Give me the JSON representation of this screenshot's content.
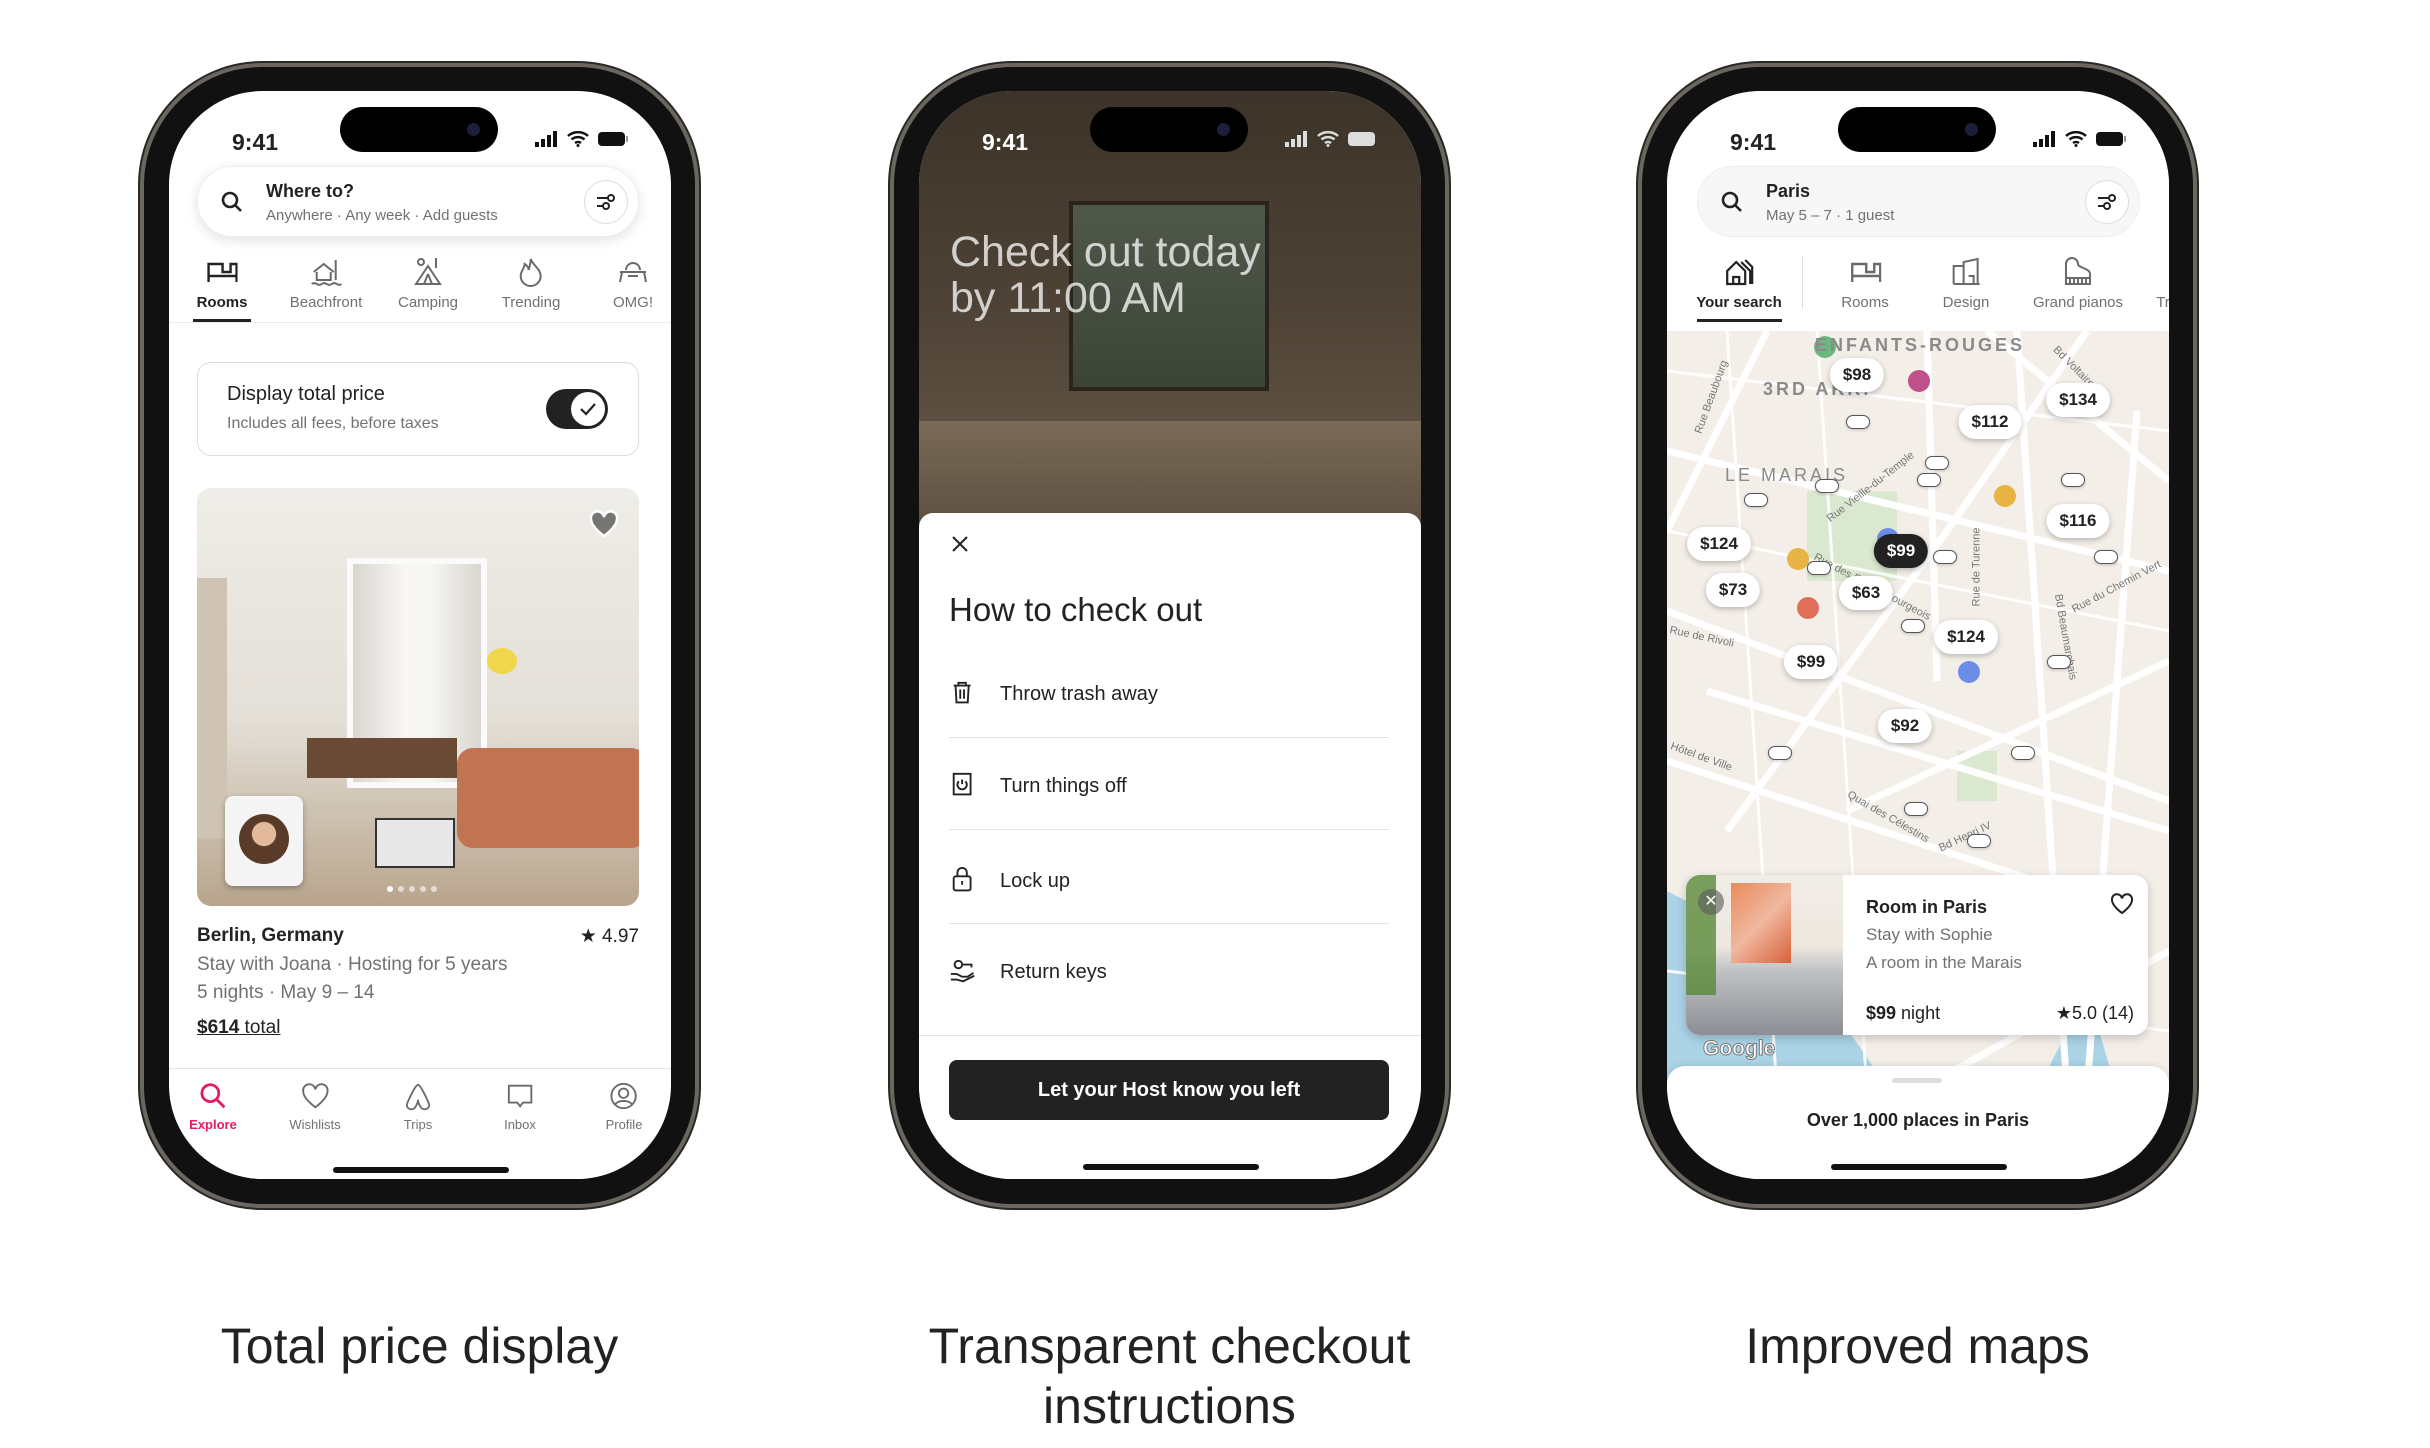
{
  "status_time": "9:41",
  "phone1": {
    "search": {
      "title": "Where to?",
      "subtitle": "Anywhere · Any week · Add guests"
    },
    "categories": [
      {
        "label": "Rooms",
        "icon": "bed-icon"
      },
      {
        "label": "Beachfront",
        "icon": "beach-house-icon"
      },
      {
        "label": "Camping",
        "icon": "tent-icon"
      },
      {
        "label": "Trending",
        "icon": "flame-icon"
      },
      {
        "label": "OMG!",
        "icon": "ufo-icon"
      }
    ],
    "toggle": {
      "title": "Display total price",
      "subtitle": "Includes all fees, before taxes",
      "on": true
    },
    "listing": {
      "location": "Berlin, Germany",
      "rating": "4.97",
      "host": "Stay with Joana · Hosting for 5 years",
      "dates": "5 nights · May 9 – 14",
      "price": "$614",
      "price_suffix": " total",
      "photo_count": 5,
      "photo_index": 1
    },
    "tabs": [
      {
        "label": "Explore",
        "icon": "search-icon",
        "active": true
      },
      {
        "label": "Wishlists",
        "icon": "heart-icon"
      },
      {
        "label": "Trips",
        "icon": "airbnb-logo-icon"
      },
      {
        "label": "Inbox",
        "icon": "message-icon"
      },
      {
        "label": "Profile",
        "icon": "profile-icon"
      }
    ],
    "caption": "Total price display"
  },
  "phone2": {
    "hero_line1": "Check out today",
    "hero_line2": "by 11:00 AM",
    "sheet_title": "How to check out",
    "items": [
      {
        "label": "Throw trash away",
        "icon": "trash-icon"
      },
      {
        "label": "Turn things off",
        "icon": "power-icon"
      },
      {
        "label": "Lock up",
        "icon": "lock-icon"
      },
      {
        "label": "Return keys",
        "icon": "key-hand-icon"
      }
    ],
    "button": "Let your Host know you left",
    "caption_line1": "Transparent checkout",
    "caption_line2": "instructions"
  },
  "phone3": {
    "search": {
      "title": "Paris",
      "subtitle": "May 5 – 7 · 1 guest"
    },
    "categories": [
      {
        "label": "Your search",
        "icon": "houses-icon"
      },
      {
        "label": "Rooms",
        "icon": "bed-icon"
      },
      {
        "label": "Design",
        "icon": "building-icon"
      },
      {
        "label": "Grand pianos",
        "icon": "piano-icon"
      },
      {
        "label": "Tr",
        "icon": ""
      }
    ],
    "map_labels": [
      "ENFANTS-ROUGES",
      "3RD ARR.",
      "LE MARAIS"
    ],
    "street_labels": [
      "Rue Beaubourg",
      "Rue Vieille-du-Temple",
      "Rue des Francs Bourgeois",
      "Rue de Turenne",
      "Bd Beaumarchais",
      "Rue du Chemin Vert",
      "Rue de Rivoli",
      "Hôtel de Ville",
      "Quai des Célestins",
      "Bd Henri IV",
      "Bd Voltaire"
    ],
    "prices": [
      "$98",
      "$134",
      "$112",
      "$116",
      "$124",
      "$99",
      "$73",
      "$63",
      "$124",
      "$99",
      "$92"
    ],
    "selected_price": "$99",
    "card": {
      "title": "Room in Paris",
      "host": "Stay with Sophie",
      "desc": "A room in the Marais",
      "price": "$99",
      "price_suffix": " night",
      "rating": "5.0 (14)"
    },
    "map_attribution": "Google",
    "sheet_text": "Over 1,000 places in Paris",
    "caption": "Improved maps"
  },
  "colors": {
    "accent": "#e31c5f",
    "dark": "#222222",
    "muted": "#717171"
  }
}
